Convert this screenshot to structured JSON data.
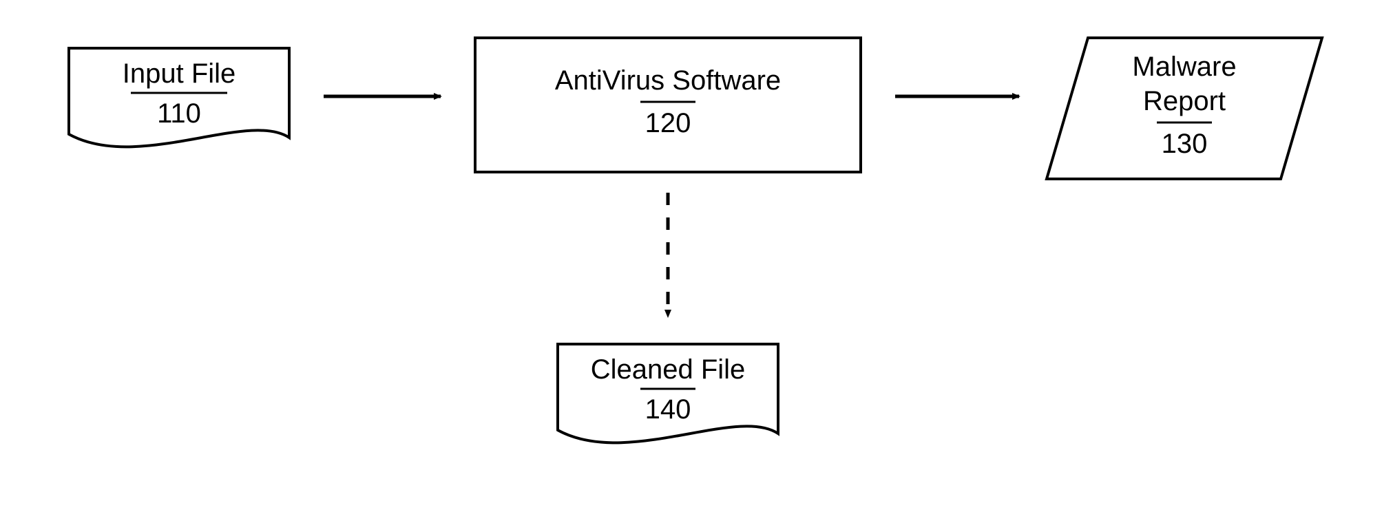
{
  "chart_data": {
    "type": "flowchart",
    "nodes": [
      {
        "id": "110",
        "label": "Input File",
        "shape": "document"
      },
      {
        "id": "120",
        "label": "AntiVirus Software",
        "shape": "process"
      },
      {
        "id": "130",
        "label": "Malware Report",
        "shape": "output",
        "multiline": [
          "Malware",
          "Report"
        ]
      },
      {
        "id": "140",
        "label": "Cleaned File",
        "shape": "document"
      }
    ],
    "edges": [
      {
        "from": "110",
        "to": "120",
        "style": "solid"
      },
      {
        "from": "120",
        "to": "130",
        "style": "solid"
      },
      {
        "from": "120",
        "to": "140",
        "style": "dashed"
      }
    ]
  },
  "nodes": {
    "input": {
      "label": "Input File",
      "num": "110"
    },
    "process": {
      "label": "AntiVirus Software",
      "num": "120"
    },
    "report": {
      "line1": "Malware",
      "line2": "Report",
      "num": "130"
    },
    "cleaned": {
      "label": "Cleaned File",
      "num": "140"
    }
  }
}
